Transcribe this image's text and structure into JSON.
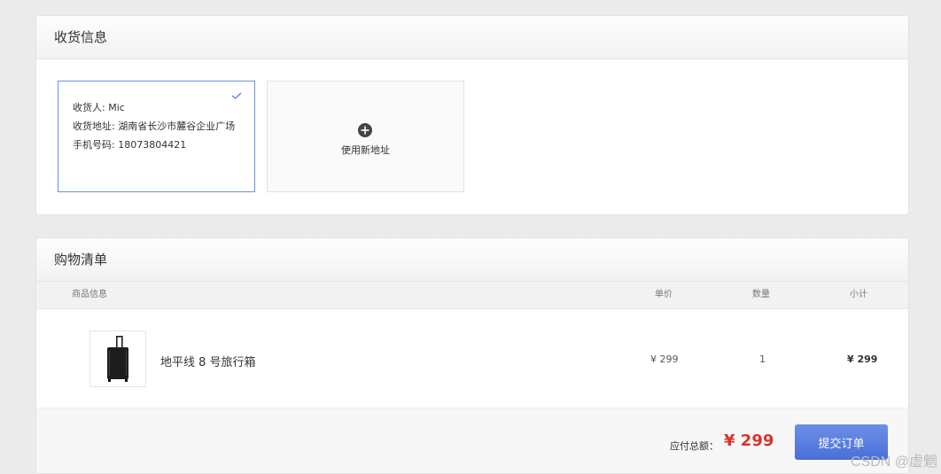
{
  "shipping": {
    "title": "收货信息",
    "selected": {
      "receiver": "收货人: Mic",
      "address": "收货地址: 湖南省长沙市麓谷企业广场",
      "phone": "手机号码: 18073804421"
    },
    "new_address_label": "使用新地址"
  },
  "cart": {
    "title": "购物清单",
    "headers": {
      "info": "商品信息",
      "price": "单价",
      "qty": "数量",
      "subtotal": "小计"
    },
    "items": [
      {
        "name": "地平线 8 号旅行箱",
        "price": "¥ 299",
        "qty": "1",
        "subtotal": "¥ 299"
      }
    ],
    "total_label": "应付总额：",
    "total_value": "¥ 299",
    "submit_label": "提交订单"
  },
  "watermark": "CSDN @虚魍",
  "colors": {
    "accent": "#5b7fdf",
    "price_red": "#d9332b",
    "selected_border": "#6f8fd6"
  }
}
